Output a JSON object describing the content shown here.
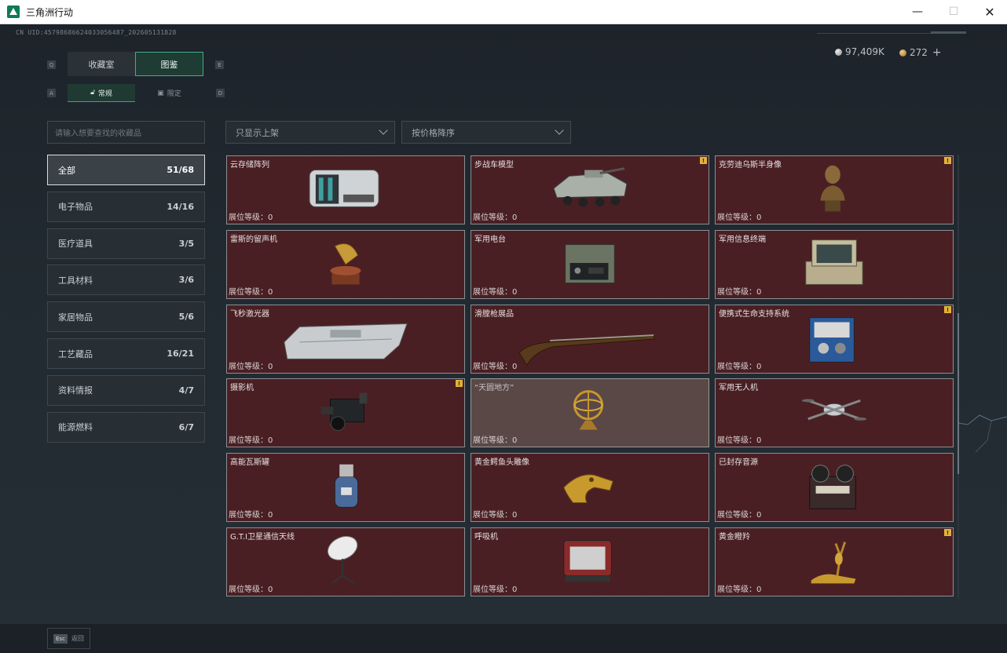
{
  "window": {
    "title": "三角洲行动",
    "minimize": "—",
    "maximize": "☐",
    "close": "✕"
  },
  "uid": "CN UID:45798686624033056487_202605131828",
  "currency": {
    "silver": "97,409K",
    "gold": "272",
    "add": "+"
  },
  "key_hints": {
    "q": "Q",
    "e": "E",
    "a": "A",
    "d": "D"
  },
  "tabs": {
    "collection_room": "收藏室",
    "catalog": "图鉴"
  },
  "subtabs": {
    "regular": "常规",
    "limited": "限定"
  },
  "search": {
    "placeholder": "请输入想要查找的收藏品"
  },
  "categories": [
    {
      "label": "全部",
      "count": "51/68"
    },
    {
      "label": "电子物品",
      "count": "14/16"
    },
    {
      "label": "医疗道具",
      "count": "3/5"
    },
    {
      "label": "工具材料",
      "count": "3/6"
    },
    {
      "label": "家居物品",
      "count": "5/6"
    },
    {
      "label": "工艺藏品",
      "count": "16/21"
    },
    {
      "label": "资料情报",
      "count": "4/7"
    },
    {
      "label": "能源燃料",
      "count": "6/7"
    }
  ],
  "filters": {
    "shelf": "只显示上架",
    "sort": "按价格降序"
  },
  "level_label": "展位等级：",
  "warning_glyph": "!",
  "items": [
    {
      "name": "云存储阵列",
      "level": "0",
      "icon": "storage-array-icon",
      "warning": false
    },
    {
      "name": "步战车模型",
      "level": "0",
      "icon": "ifv-model-icon",
      "warning": true
    },
    {
      "name": "克劳迪乌斯半身像",
      "level": "0",
      "icon": "bust-icon",
      "warning": true
    },
    {
      "name": "雷斯的留声机",
      "level": "0",
      "icon": "gramophone-icon",
      "warning": false
    },
    {
      "name": "军用电台",
      "level": "0",
      "icon": "radio-icon",
      "warning": false
    },
    {
      "name": "军用信息终端",
      "level": "0",
      "icon": "terminal-icon",
      "warning": false
    },
    {
      "name": "飞秒激光器",
      "level": "0",
      "icon": "laser-case-icon",
      "warning": false
    },
    {
      "name": "滑膛枪展品",
      "level": "0",
      "icon": "musket-icon",
      "warning": false
    },
    {
      "name": "便携式生命支持系统",
      "level": "0",
      "icon": "life-support-icon",
      "warning": true
    },
    {
      "name": "摄影机",
      "level": "0",
      "icon": "camera-icon",
      "warning": true
    },
    {
      "name": "“天圆地方”",
      "level": "0",
      "icon": "armillary-icon",
      "warning": false
    },
    {
      "name": "军用无人机",
      "level": "0",
      "icon": "drone-icon",
      "warning": false
    },
    {
      "name": "高能瓦斯罐",
      "level": "0",
      "icon": "gas-tank-icon",
      "warning": false
    },
    {
      "name": "黄金鳄鱼头雕像",
      "level": "0",
      "icon": "crocodile-head-icon",
      "warning": false
    },
    {
      "name": "已封存音源",
      "level": "0",
      "icon": "reel-player-icon",
      "warning": false
    },
    {
      "name": "G.T.I卫星通信天线",
      "level": "0",
      "icon": "satellite-dish-icon",
      "warning": false
    },
    {
      "name": "呼吸机",
      "level": "0",
      "icon": "ventilator-icon",
      "warning": false
    },
    {
      "name": "黄金瞪羚",
      "level": "0",
      "icon": "gazelle-icon",
      "warning": true
    }
  ],
  "footer": {
    "esc": "Esc",
    "back": "返回"
  }
}
